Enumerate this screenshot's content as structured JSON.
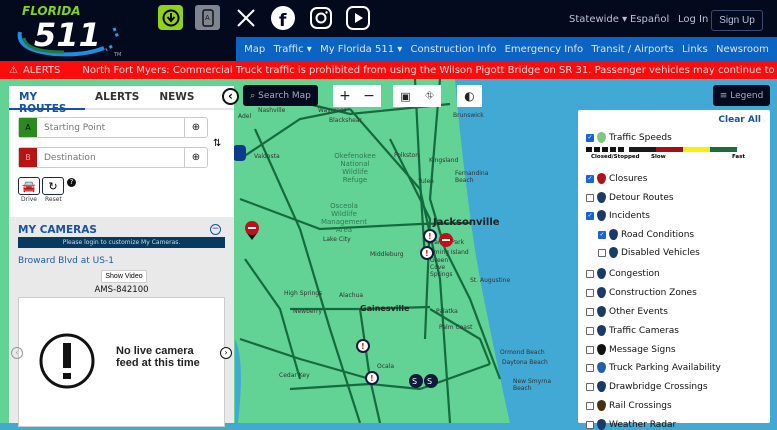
{
  "header": {
    "logo_text": "FLORIDA 511",
    "region": "Statewide",
    "language": "Español",
    "login": "Log In",
    "signup": "Sign Up"
  },
  "social": [
    "download-app",
    "mobile-app",
    "x",
    "facebook",
    "instagram",
    "youtube"
  ],
  "nav": [
    "Map",
    "Traffic ▾",
    "My Florida 511 ▾",
    "Construction Info",
    "Emergency Info",
    "Transit / Airports",
    "Links",
    "Newsroom"
  ],
  "alert": {
    "label": "ALERTS",
    "text": "North Fort Myers: Commercial Truck traffic is prohibited from using the Wilson Pigott Bridge on SR 31. Passenger vehicles may continue to use the bridge. Commercial"
  },
  "panel": {
    "tabs": [
      "MY ROUTES",
      "ALERTS",
      "NEWS"
    ],
    "start": {
      "letter": "A",
      "placeholder": "Starting Point"
    },
    "dest": {
      "letter": "B",
      "placeholder": "Destination"
    },
    "drive": "Drive",
    "reset": "Reset",
    "cameras": {
      "title": "MY CAMERAS",
      "login_msg": "Please login to customize My Cameras.",
      "camera_name": "Broward Blvd at US-1",
      "show_video": "Show Video",
      "camera_id": "AMS-842100",
      "no_feed": "No live camera feed at this time"
    }
  },
  "map_controls": {
    "search": "Search Map",
    "zoom_in": "+",
    "zoom_out": "−",
    "legend": "Legend"
  },
  "map_labels": [
    "Blackshear",
    "Waycross",
    "Nashville",
    "Adel",
    "Brunswick",
    "Valdosta",
    "Folkston",
    "Kingsland",
    "Fernandina Beach",
    "Yulee",
    "Okefenokee National Wildlife Refuge",
    "Osceola Wildlife Management Area",
    "Lake City",
    "Jacksonville",
    "Orange Park",
    "Fleming Island",
    "Green Cove Springs",
    "Middleburg",
    "St. Augustine",
    "High Springs",
    "Alachua",
    "Newberry",
    "Gainesville",
    "Palatka",
    "Palm Coast",
    "Ormond Beach",
    "Daytona Beach",
    "New Smyrna Beach",
    "Ocala",
    "Cedar Key"
  ],
  "legend": {
    "clear_all": "Clear All",
    "speed_labels": [
      "Closed/Stopped",
      "Slow",
      "Fast"
    ],
    "speed_colors": [
      "#1a1a1a",
      "#a50e0e",
      "#f2f20a",
      "#1d6b3a"
    ],
    "items": [
      {
        "label": "Traffic Speeds",
        "checked": true
      },
      {
        "label": "Closures",
        "checked": true
      },
      {
        "label": "Detour Routes",
        "checked": false
      },
      {
        "label": "Incidents",
        "checked": true
      },
      {
        "label": "Road Conditions",
        "checked": true
      },
      {
        "label": "Disabled Vehicles",
        "checked": false
      },
      {
        "label": "Congestion",
        "checked": false
      },
      {
        "label": "Construction Zones",
        "checked": false
      },
      {
        "label": "Other Events",
        "checked": false
      },
      {
        "label": "Traffic Cameras",
        "checked": false
      },
      {
        "label": "Message Signs",
        "checked": false
      },
      {
        "label": "Truck Parking Availability",
        "checked": false
      },
      {
        "label": "Drawbridge Crossings",
        "checked": false
      },
      {
        "label": "Rail Crossings",
        "checked": false
      },
      {
        "label": "Weather Radar",
        "checked": false
      }
    ]
  }
}
